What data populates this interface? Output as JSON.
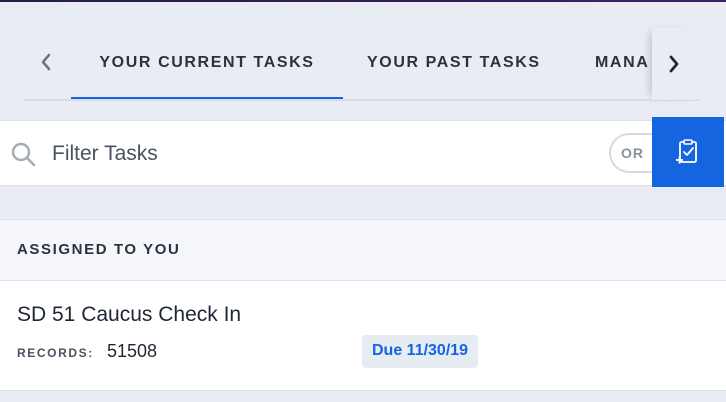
{
  "tabs": {
    "items": [
      {
        "label": "YOUR CURRENT TASKS",
        "active": true
      },
      {
        "label": "YOUR PAST TASKS",
        "active": false
      },
      {
        "label": "MANA",
        "active": false
      }
    ],
    "prev_icon": "chevron-left-icon",
    "next_icon": "chevron-right-icon"
  },
  "filter": {
    "placeholder": "Filter Tasks",
    "value": "",
    "or_label": "OR",
    "search_icon": "search-icon",
    "new_task_icon": "clipboard-add-icon"
  },
  "section": {
    "title": "ASSIGNED TO YOU",
    "tasks": [
      {
        "title": "SD 51 Caucus Check In",
        "records_label": "RECORDS:",
        "records_value": "51508",
        "due": "Due 11/30/19"
      }
    ]
  },
  "colors": {
    "accent": "#1565e0",
    "background": "#e9ecf3",
    "surface": "#ffffff"
  }
}
